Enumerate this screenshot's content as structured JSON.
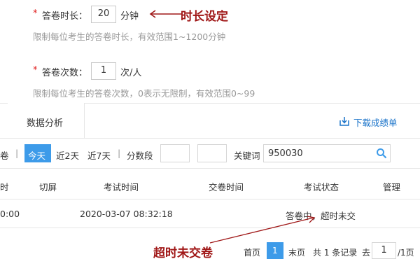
{
  "settings": {
    "duration": {
      "required_mark": "*",
      "label": "答卷时长：",
      "value": "20",
      "unit": "分钟",
      "hint": "限制每位考生的答卷时长，有效范围1~1200分钟",
      "annotation": "时长设定"
    },
    "attempts": {
      "required_mark": "*",
      "label": "答卷次数：",
      "value": "1",
      "unit": "次/人",
      "hint": "限制每位考生的答卷次数，0表示无限制，有效范围0~99"
    }
  },
  "tabs": {
    "active_label": "数据分析",
    "download_label": "下载成绩单"
  },
  "filters": {
    "partial_label": "卷",
    "divider": "|",
    "today": "今天",
    "last2": "近2天",
    "last7": "近7天",
    "divider2": "|",
    "score_range": "分数段",
    "keyword_label": "关键词",
    "keyword_value": "950030"
  },
  "table": {
    "headers": [
      "时",
      "切屏",
      "考试时间",
      "交卷时间",
      "考试状态",
      "管理"
    ],
    "rows": [
      {
        "time_partial": "0:00",
        "switch": "",
        "exam_time": "2020-03-07 08:32:18",
        "submit_time": "",
        "status": "答卷中，超时未交",
        "manage": ""
      }
    ]
  },
  "annotation_bottom": "超时未交卷",
  "pagination": {
    "first": "首页",
    "current": "1",
    "last": "末页",
    "summary": "共 1 条记录",
    "goto": "去",
    "goto_value": "1",
    "total": "/1页"
  },
  "colors": {
    "accent": "#3d9be9",
    "annotation": "#a01818",
    "required": "#e02020"
  }
}
